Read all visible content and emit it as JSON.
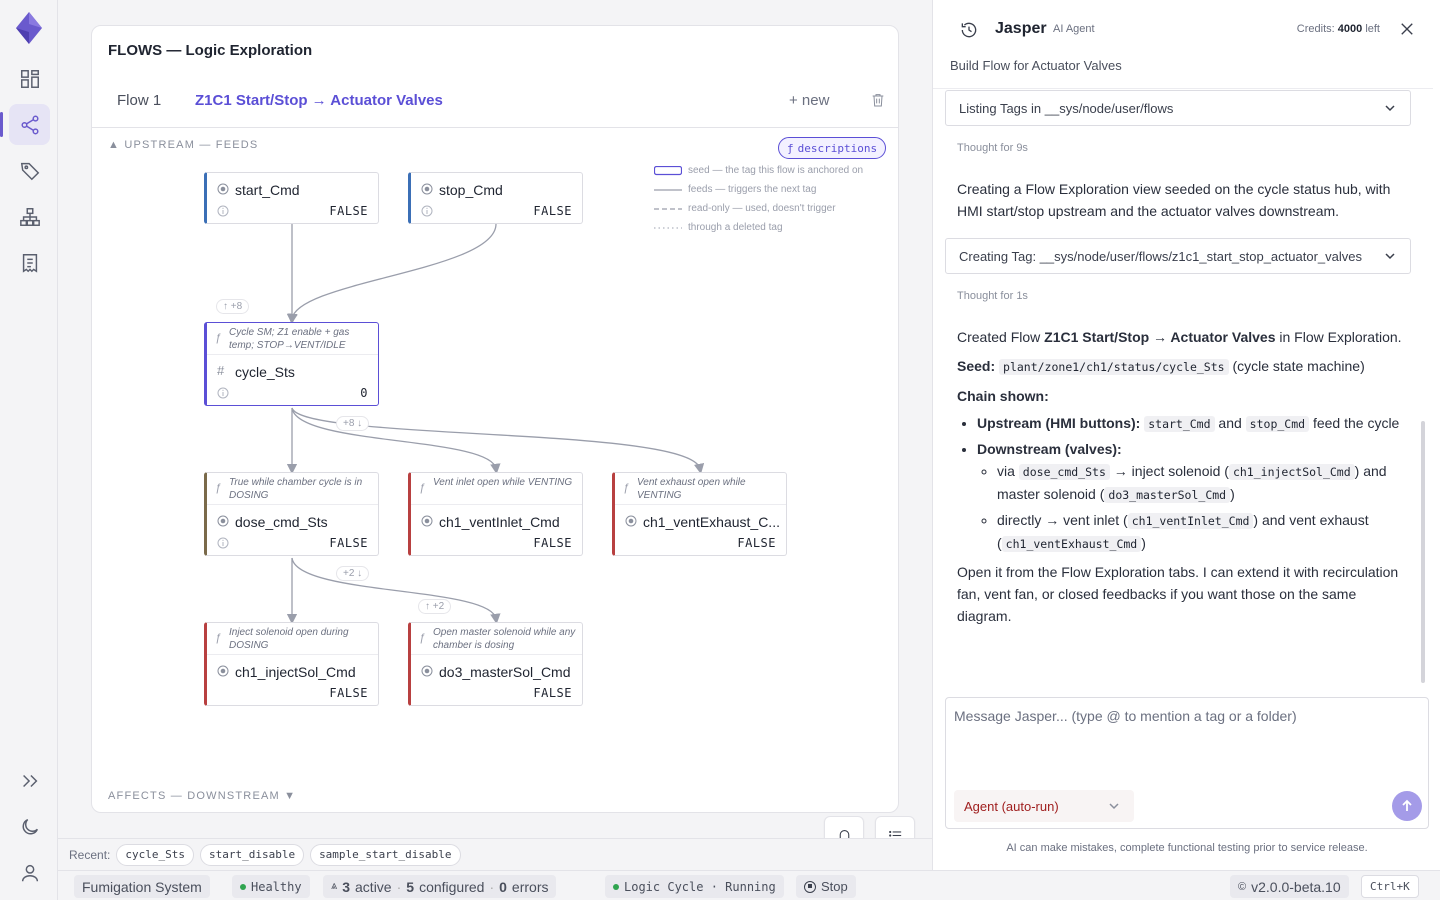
{
  "canvas": {
    "title": "FLOWS — Logic Exploration",
    "tabs": [
      {
        "label": "Flow 1"
      },
      {
        "label": "Z1C1 Start/Stop → Actuator Valves"
      }
    ],
    "new_label": "+ new",
    "upstream_label": "▲ UPSTREAM — FEEDS",
    "downstream_label": "AFFECTS — DOWNSTREAM ▼",
    "descriptions_label": "descriptions",
    "legend": [
      {
        "text": "seed — the tag this flow is anchored on"
      },
      {
        "text": "feeds — triggers the next tag"
      },
      {
        "text": "read-only — used, doesn't trigger"
      },
      {
        "text": "through a deleted tag"
      }
    ],
    "badges": {
      "up_cycle": "↑ +8",
      "down_cycle": "+8 ↓",
      "down_dose": "+2 ↓",
      "up_master": "↑ +2"
    },
    "nodes": [
      {
        "name": "start_Cmd",
        "value": "FALSE",
        "desc": ""
      },
      {
        "name": "stop_Cmd",
        "value": "FALSE",
        "desc": ""
      },
      {
        "name": "cycle_Sts",
        "value": "0",
        "desc": "Cycle SM; Z1 enable + gas temp; STOP→VENT/IDLE"
      },
      {
        "name": "dose_cmd_Sts",
        "value": "FALSE",
        "desc": "True while chamber cycle is in DOSING"
      },
      {
        "name": "ch1_ventInlet_Cmd",
        "value": "FALSE",
        "desc": "Vent inlet open while VENTING"
      },
      {
        "name": "ch1_ventExhaust_C...",
        "value": "FALSE",
        "desc": "Vent exhaust open while VENTING"
      },
      {
        "name": "ch1_injectSol_Cmd",
        "value": "FALSE",
        "desc": "Inject solenoid open during DOSING"
      },
      {
        "name": "do3_masterSol_Cmd",
        "value": "FALSE",
        "desc": "Open master solenoid while any chamber is dosing"
      }
    ]
  },
  "recent": {
    "label": "Recent:",
    "items": [
      "cycle_Sts",
      "start_disable",
      "sample_start_disable"
    ]
  },
  "statusbar": {
    "system": "Fumigation System",
    "health": "Healthy",
    "active_count": "3",
    "active_label": "active",
    "configured_count": "5",
    "configured_label": "configured",
    "errors_count": "0",
    "errors_label": "errors",
    "logic_cycle": "Logic Cycle · Running",
    "stop_label": "Stop",
    "version": "v2.0.0-beta.10",
    "shortcut": "Ctrl+K"
  },
  "panel": {
    "agent_name": "Jasper",
    "agent_role": "AI Agent",
    "credits_label": "Credits:",
    "credits_value": "4000",
    "credits_suffix": "left",
    "task_title": "Build Flow for Actuator Valves",
    "tool1": "Listing Tags in __sys/node/user/flows",
    "thought1": "Thought for 9s",
    "msg1": "Creating a Flow Exploration view seeded on the cycle status hub, with HMI start/stop upstream and the actuator valves downstream.",
    "tool2": "Creating Tag: __sys/node/user/flows/z1c1_start_stop_actuator_valves",
    "thought2": "Thought for 1s",
    "created_prefix": "Created Flow",
    "created_name": "Z1C1 Start/Stop → Actuator Valves",
    "created_suffix": "in Flow Exploration.",
    "seed_label": "Seed:",
    "seed_path": "plant/zone1/ch1/status/cycle_Sts",
    "seed_note": "(cycle state machine)",
    "chain_label": "Chain shown:",
    "upstream_label": "Upstream (HMI buttons):",
    "up_tag1": "start_Cmd",
    "up_and": "and",
    "up_tag2": "stop_Cmd",
    "up_tail": "feed the cycle",
    "downstream_label": "Downstream (valves):",
    "via": "via",
    "via_tag": "dose_cmd_Sts",
    "via_arrow": "→ inject solenoid (",
    "inject_tag": "ch1_injectSol_Cmd",
    "and_master": ") and master solenoid (",
    "master_tag": "do3_masterSol_Cmd",
    "close_paren": ")",
    "directly": "directly → vent inlet (",
    "vent_inlet_tag": "ch1_ventInlet_Cmd",
    "vent_exhaust_text": ") and vent exhaust (",
    "vent_exhaust_tag": "ch1_ventExhaust_Cmd",
    "close_paren2": ")",
    "closing": "Open it from the Flow Exploration tabs. I can extend it with recirculation fan, vent fan, or closed feedbacks if you want those on the same diagram.",
    "composer_placeholder": "Message Jasper... (type @ to mention a tag or a folder)",
    "agent_mode": "Agent (auto-run)",
    "disclaimer": "AI can make mistakes, complete functional testing prior to service release."
  },
  "colors": {
    "accent": "#5b4fd6",
    "feeds_blue": "#3b6fb6",
    "actuator_red": "#b84040",
    "healthy": "#2fa44f"
  }
}
